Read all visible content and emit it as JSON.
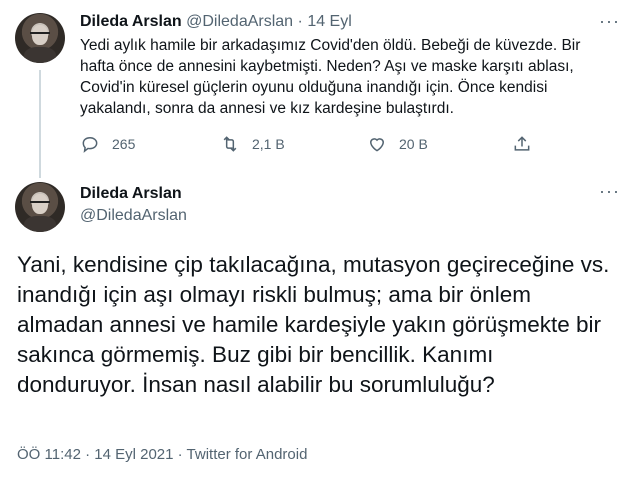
{
  "first_tweet": {
    "name": "Dileda Arslan",
    "handle": "@DiledaArslan",
    "separator": "·",
    "date": "14 Eyl",
    "text": "Yedi aylık hamile bir arkadaşımız Covid'den öldü. Bebeği de küvezde. Bir hafta önce de annesini kaybetmişti. Neden? Aşı ve maske karşıtı ablası, Covid'in küresel güçlerin oyunu olduğuna inandığı için. Önce kendisi yakalandı, sonra da annesi ve kız kardeşine bulaştırdı.",
    "more_label": "···",
    "actions": {
      "reply_count": "265",
      "retweet_count": "2,1 B",
      "like_count": "20 B"
    }
  },
  "second_tweet": {
    "name": "Dileda Arslan",
    "handle": "@DiledaArslan",
    "more_label": "···",
    "text": "Yani, kendisine çip takılacağına, mutasyon geçireceğine vs. inandığı için aşı olmayı riskli bulmuş; ama bir önlem almadan annesi ve hamile kardeşiyle yakın görüşmekte bir sakınca görmemiş. Buz gibi bir bencillik. Kanımı donduruyor. İnsan nasıl alabilir bu sorumluluğu?",
    "meta": "ÖÖ 11:42 · 14 Eyl 2021 · Twitter for Android"
  },
  "icons": {
    "reply": "reply-icon",
    "retweet": "retweet-icon",
    "like": "heart-icon",
    "share": "share-icon",
    "more": "more-icon"
  },
  "colors": {
    "text": "#0f1419",
    "muted": "#536471",
    "thread_line": "#cfd9de",
    "background": "#ffffff"
  }
}
